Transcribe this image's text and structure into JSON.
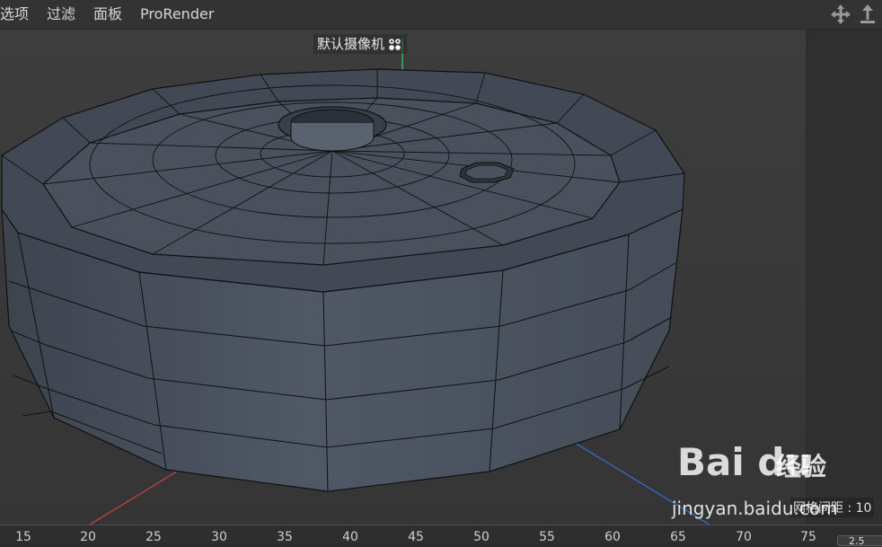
{
  "menu": {
    "items": [
      {
        "label": "选项"
      },
      {
        "label": "过滤"
      },
      {
        "label": "面板"
      },
      {
        "label": "ProRender"
      }
    ]
  },
  "viewport": {
    "camera_label": "默认摄像机",
    "grid_spacing": "网格间距 : 10",
    "ruler_ticks": [
      "15",
      "20",
      "25",
      "30",
      "35",
      "40",
      "45",
      "50",
      "55",
      "60",
      "65",
      "70",
      "75"
    ],
    "ruler_value": "2.5"
  },
  "watermark": {
    "logo": "Bai du",
    "subtitle": "经验",
    "url": "jingyan.baidu.com"
  },
  "icons": {
    "move": "move-view-icon",
    "pan": "pan-vertical-icon"
  },
  "colors": {
    "axis_x": "#c84848",
    "axis_y": "#36c06a",
    "axis_z": "#3b6fd4",
    "mesh_face": "#4a5260",
    "mesh_edge": "#111111"
  }
}
